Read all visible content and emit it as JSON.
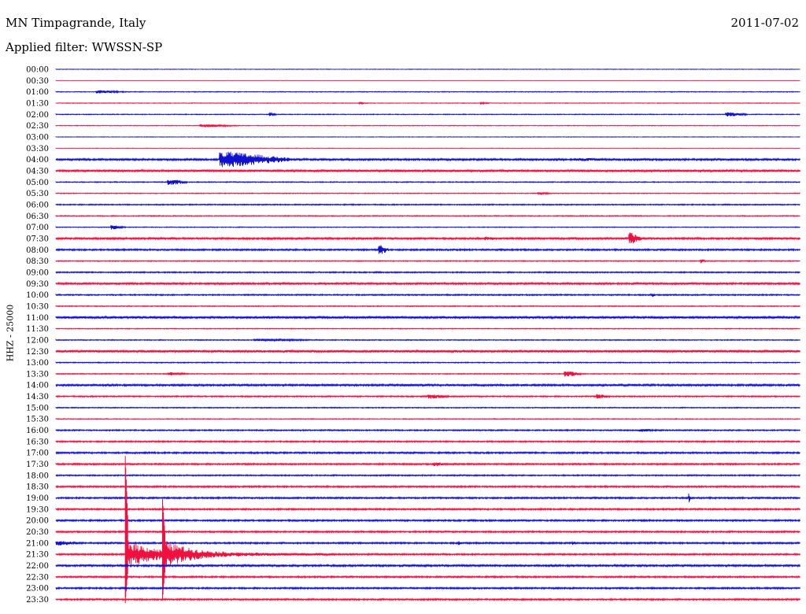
{
  "header": {
    "station": "MN Timpagrande, Italy",
    "filter": "Applied filter: WWSSN-SP",
    "date": "2011-07-02"
  },
  "chart_data": {
    "type": "line",
    "ylabel": "HHZ - 25000",
    "trace_colors": [
      "#1010d0",
      "#f01040"
    ],
    "row_labels": [
      "00:00",
      "00:30",
      "01:00",
      "01:30",
      "02:00",
      "02:30",
      "03:00",
      "03:30",
      "04:00",
      "04:30",
      "05:00",
      "05:30",
      "06:00",
      "06:30",
      "07:00",
      "07:30",
      "08:00",
      "08:30",
      "09:00",
      "09:30",
      "10:00",
      "10:30",
      "11:00",
      "11:30",
      "12:00",
      "12:30",
      "13:00",
      "13:30",
      "14:00",
      "14:30",
      "15:00",
      "15:30",
      "16:00",
      "16:30",
      "17:00",
      "17:30",
      "18:00",
      "18:30",
      "19:00",
      "19:30",
      "20:00",
      "20:30",
      "21:00",
      "21:30",
      "22:00",
      "22:30",
      "23:00",
      "23:30"
    ],
    "noise_level": [
      0.3,
      0.2,
      0.5,
      0.4,
      0.5,
      0.4,
      0.3,
      0.3,
      1.2,
      1.4,
      0.6,
      0.5,
      0.7,
      0.6,
      0.5,
      1.2,
      1.0,
      0.6,
      0.8,
      1.2,
      0.8,
      0.6,
      1.4,
      0.5,
      0.6,
      1.5,
      0.6,
      0.6,
      1.2,
      0.8,
      0.6,
      0.5,
      0.8,
      0.9,
      1.0,
      1.0,
      0.8,
      1.0,
      1.0,
      1.0,
      1.0,
      1.0,
      1.0,
      1.0,
      1.2,
      1.0,
      1.0,
      1.0
    ],
    "events": [
      {
        "row": "01:00",
        "minute": 1.6,
        "duration": 1.3,
        "amplitude": 2
      },
      {
        "row": "01:30",
        "minute": 12.2,
        "duration": 0.4,
        "amplitude": 1.5
      },
      {
        "row": "01:30",
        "minute": 17.1,
        "duration": 0.4,
        "amplitude": 1.5
      },
      {
        "row": "02:00",
        "minute": 8.6,
        "duration": 0.3,
        "amplitude": 3
      },
      {
        "row": "02:00",
        "minute": 27.0,
        "duration": 0.9,
        "amplitude": 3
      },
      {
        "row": "02:30",
        "minute": 5.8,
        "duration": 1.6,
        "amplitude": 2
      },
      {
        "row": "04:00",
        "minute": 6.6,
        "duration": 2.8,
        "amplitude": 10
      },
      {
        "row": "04:00",
        "minute": 20.9,
        "duration": 2.2,
        "amplitude": 2
      },
      {
        "row": "05:00",
        "minute": 4.5,
        "duration": 0.8,
        "amplitude": 4
      },
      {
        "row": "05:30",
        "minute": 19.4,
        "duration": 0.7,
        "amplitude": 1.5
      },
      {
        "row": "07:00",
        "minute": 2.2,
        "duration": 0.6,
        "amplitude": 3
      },
      {
        "row": "07:30",
        "minute": 17.3,
        "duration": 0.5,
        "amplitude": 3
      },
      {
        "row": "07:30",
        "minute": 23.1,
        "duration": 0.5,
        "amplitude": 8
      },
      {
        "row": "08:00",
        "minute": 13.0,
        "duration": 0.4,
        "amplitude": 7
      },
      {
        "row": "08:30",
        "minute": 26.0,
        "duration": 0.2,
        "amplitude": 3
      },
      {
        "row": "10:00",
        "minute": 24.0,
        "duration": 0.2,
        "amplitude": 3
      },
      {
        "row": "12:00",
        "minute": 8.0,
        "duration": 3.5,
        "amplitude": 1.5
      },
      {
        "row": "13:30",
        "minute": 4.5,
        "duration": 1.0,
        "amplitude": 2
      },
      {
        "row": "13:30",
        "minute": 20.5,
        "duration": 0.7,
        "amplitude": 4
      },
      {
        "row": "14:30",
        "minute": 15.0,
        "duration": 1.0,
        "amplitude": 3
      },
      {
        "row": "14:30",
        "minute": 21.8,
        "duration": 0.6,
        "amplitude": 3
      },
      {
        "row": "16:00",
        "minute": 23.5,
        "duration": 1.0,
        "amplitude": 2
      },
      {
        "row": "17:30",
        "minute": 15.2,
        "duration": 0.7,
        "amplitude": 3
      },
      {
        "row": "19:00",
        "minute": 25.5,
        "duration": 0.1,
        "amplitude": 7
      },
      {
        "row": "21:00",
        "minute": 0.0,
        "duration": 1.2,
        "amplitude": 3
      },
      {
        "row": "21:00",
        "minute": 16.2,
        "duration": 0.2,
        "amplitude": 3
      },
      {
        "row": "21:00",
        "minute": 20.8,
        "duration": 0.2,
        "amplitude": 3
      }
    ],
    "major_events": [
      {
        "row": "21:30",
        "minute": 2.8,
        "peak_up": 125,
        "peak_down": 62
      },
      {
        "row": "21:30",
        "minute": 4.3,
        "peak_up": 70,
        "peak_down": 58
      }
    ]
  }
}
